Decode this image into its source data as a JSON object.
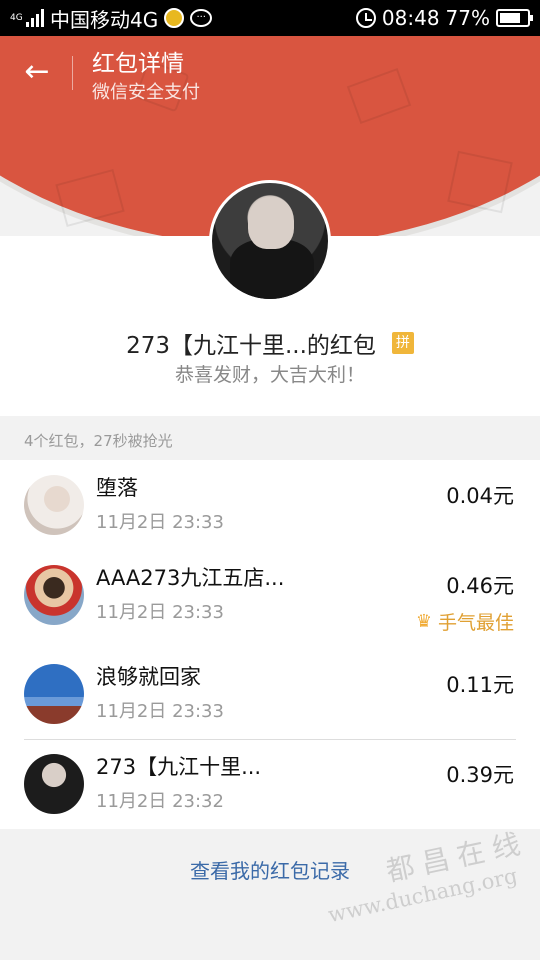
{
  "status_bar": {
    "carrier": "中国移动4G",
    "time": "08:48",
    "battery": "77%",
    "battery_level": 0.77,
    "network_tag": "4G",
    "icons": [
      "signal-icon",
      "app-icon",
      "chat-icon",
      "alarm-icon",
      "battery-icon"
    ]
  },
  "header": {
    "back_icon": "←",
    "title": "红包详情",
    "subtitle": "微信安全支付",
    "bg_color": "#d95540"
  },
  "sender": {
    "name": "273【九江十里...的红包",
    "badge": "拼",
    "greeting": "恭喜发财，大吉大利！"
  },
  "summary": "4个红包，27秒被抢光",
  "recipients": [
    {
      "name": "堕落",
      "time": "11月2日   23:33",
      "amount": "0.04元"
    },
    {
      "name": "AAA273九江五店...",
      "time": "11月2日   23:33",
      "amount": "0.46元",
      "badge": "手气最佳",
      "badge_icon": "crown-icon"
    },
    {
      "name": "浪够就回家",
      "time": "11月2日   23:33",
      "amount": "0.11元"
    },
    {
      "name": "273【九江十里...",
      "time": "11月2日   23:32",
      "amount": "0.39元"
    }
  ],
  "records_link": "查看我的红包记录",
  "watermark": {
    "text": "都昌在线",
    "url": "www.duchang.org"
  },
  "colors": {
    "accent": "#d95540",
    "link": "#3b6aa8",
    "best_luck": "#e0a033",
    "page_bg": "#f2f2f2"
  }
}
